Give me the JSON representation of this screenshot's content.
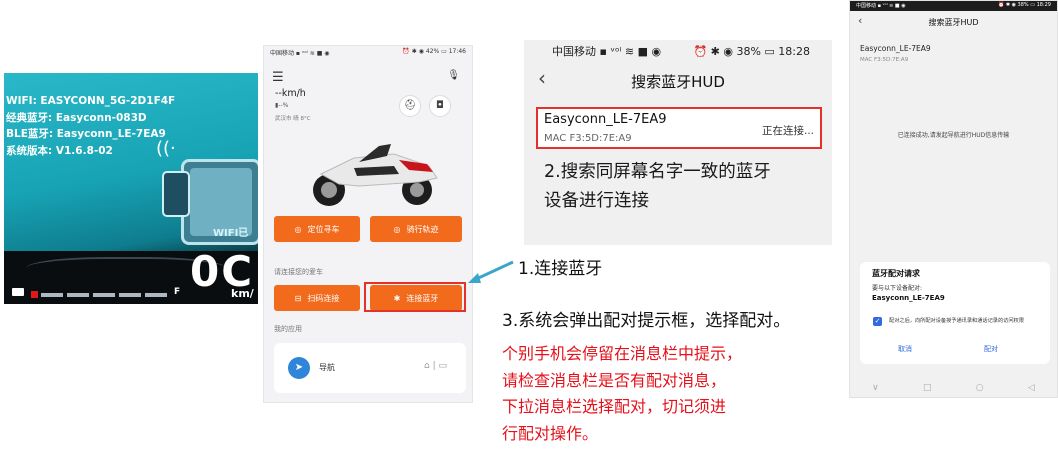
{
  "hud": {
    "wifi": "WIFI: EASYCONN_5G-2D1F4F",
    "classic_bt": "经典蓝牙: Easyconn-083D",
    "ble": "BLE蓝牙: Easyconn_LE-7EA9",
    "version": "系统版本: V1.6.8-02",
    "wifi_short": "WIFI已",
    "speed": "0C",
    "unit": "km/",
    "fuel_mark": "F"
  },
  "app": {
    "status_left": "中国移动 ▪ ᵛᵒˡ ≋ ■ ◉",
    "status_right": "⏰ ✱ ◉ 42% ▭ 17:46",
    "speed": "--km/h",
    "battery": "▮--%",
    "weather": "武汉市 晴 8°C",
    "btn_locate": "定位寻车",
    "btn_track": "骑行轨迹",
    "section_car": "请连接您的爱车",
    "btn_scan": "扫码连接",
    "btn_bt": "连接蓝牙",
    "section_apps": "我的应用",
    "nav_label": "导航"
  },
  "search": {
    "status_left": "中国移动 ▪ ᵛᵒˡ ≋ ■ ◉",
    "status_right": "⏰ ✱ ◉ 38% ▭ 18:28",
    "title": "搜索蓝牙HUD",
    "device": "Easyconn_LE-7EA9",
    "mac": "MAC F3:5D:7E:A9",
    "state": "正在连接...",
    "step2_line1": "2.搜索同屏幕名字一致的蓝牙",
    "step2_line2": "设备进行连接"
  },
  "pair": {
    "status_left": "中国移动 ▪ ᵛᵒˡ ≋ ■ ◉",
    "status_right": "⏰ ✱ ◉ 38% ▭ 18:29",
    "title": "搜索蓝牙HUD",
    "device": "Easyconn_LE-7EA9",
    "mac": "MAC F3:5D:7E:A9",
    "done_text": "已连接成功,请发起导航进行HUD信息传输",
    "dialog_title": "蓝牙配对请求",
    "dialog_sub": "要与以下设备配对:",
    "dialog_name": "Easyconn_LE-7EA9",
    "dialog_note": "配对之后，向所配对设备授予通讯录和通话记录的访问权限",
    "cancel": "取消",
    "confirm": "配对"
  },
  "captions": {
    "step1": "1.连接蓝牙",
    "step3": "3.系统会弹出配对提示框，选择配对。",
    "note1": "个别手机会停留在消息栏中提示，",
    "note2": "请检查消息栏是否有配对消息，",
    "note3": "下拉消息栏选择配对，切记须进",
    "note4": "行配对操作。"
  },
  "colors": {
    "accent_orange": "#f26b1d",
    "highlight_red": "#e4322b",
    "note_red": "#e5101a",
    "arrow_blue": "#3aa6c9"
  }
}
